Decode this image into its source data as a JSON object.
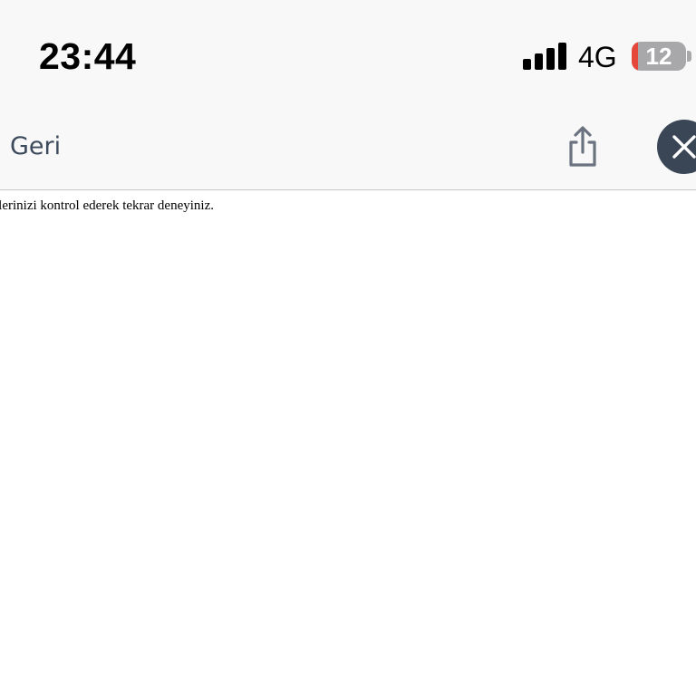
{
  "status_bar": {
    "time": "23:44",
    "network": "4G",
    "signal_icon": "cellular-signal-icon",
    "signal_bars": 4,
    "battery_icon": "battery-icon",
    "battery_level": "12",
    "battery_fill_percent": 12,
    "battery_low_color": "#e5473a"
  },
  "nav_bar": {
    "back_label": "Geri",
    "share_icon": "share-icon",
    "close_icon": "close-icon"
  },
  "content": {
    "message": "ilerinizi kontrol ederek tekrar deneyiniz."
  },
  "colors": {
    "bar_background": "#f8f8f8",
    "back_label": "#3d4a5c",
    "close_button": "#3a4656",
    "share_icon": "#6b7280"
  }
}
